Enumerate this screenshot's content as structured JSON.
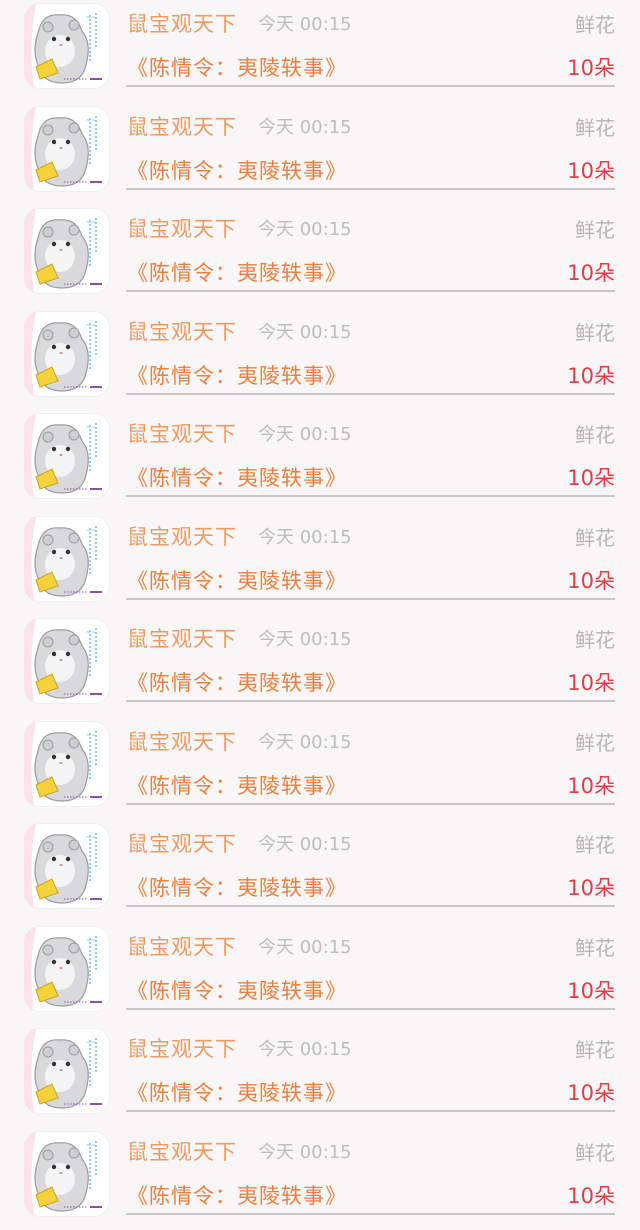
{
  "items": [
    {
      "name": "鼠宝观天下",
      "time": "今天 00:15",
      "type": "鲜花",
      "book": "《陈情令：夷陵轶事》",
      "amount": "10朵",
      "avatar_icon": "hamster-avatar-icon"
    },
    {
      "name": "鼠宝观天下",
      "time": "今天 00:15",
      "type": "鲜花",
      "book": "《陈情令：夷陵轶事》",
      "amount": "10朵",
      "avatar_icon": "hamster-avatar-icon"
    },
    {
      "name": "鼠宝观天下",
      "time": "今天 00:15",
      "type": "鲜花",
      "book": "《陈情令：夷陵轶事》",
      "amount": "10朵",
      "avatar_icon": "hamster-avatar-icon"
    },
    {
      "name": "鼠宝观天下",
      "time": "今天 00:15",
      "type": "鲜花",
      "book": "《陈情令：夷陵轶事》",
      "amount": "10朵",
      "avatar_icon": "hamster-avatar-icon"
    },
    {
      "name": "鼠宝观天下",
      "time": "今天 00:15",
      "type": "鲜花",
      "book": "《陈情令：夷陵轶事》",
      "amount": "10朵",
      "avatar_icon": "hamster-avatar-icon"
    },
    {
      "name": "鼠宝观天下",
      "time": "今天 00:15",
      "type": "鲜花",
      "book": "《陈情令：夷陵轶事》",
      "amount": "10朵",
      "avatar_icon": "hamster-avatar-icon"
    },
    {
      "name": "鼠宝观天下",
      "time": "今天 00:15",
      "type": "鲜花",
      "book": "《陈情令：夷陵轶事》",
      "amount": "10朵",
      "avatar_icon": "hamster-avatar-icon"
    },
    {
      "name": "鼠宝观天下",
      "time": "今天 00:15",
      "type": "鲜花",
      "book": "《陈情令：夷陵轶事》",
      "amount": "10朵",
      "avatar_icon": "hamster-avatar-icon"
    },
    {
      "name": "鼠宝观天下",
      "time": "今天 00:15",
      "type": "鲜花",
      "book": "《陈情令：夷陵轶事》",
      "amount": "10朵",
      "avatar_icon": "hamster-avatar-icon"
    },
    {
      "name": "鼠宝观天下",
      "time": "今天 00:15",
      "type": "鲜花",
      "book": "《陈情令：夷陵轶事》",
      "amount": "10朵",
      "avatar_icon": "hamster-avatar-icon"
    },
    {
      "name": "鼠宝观天下",
      "time": "今天 00:15",
      "type": "鲜花",
      "book": "《陈情令：夷陵轶事》",
      "amount": "10朵",
      "avatar_icon": "hamster-avatar-icon"
    },
    {
      "name": "鼠宝观天下",
      "time": "今天 00:15",
      "type": "鲜花",
      "book": "《陈情令：夷陵轶事》",
      "amount": "10朵",
      "avatar_icon": "hamster-avatar-icon"
    }
  ],
  "colors": {
    "name": "#f09a62",
    "book": "#ee7f3e",
    "amount": "#ea3a45",
    "muted": "#c0bcbc",
    "background": "#f8f6f7"
  }
}
